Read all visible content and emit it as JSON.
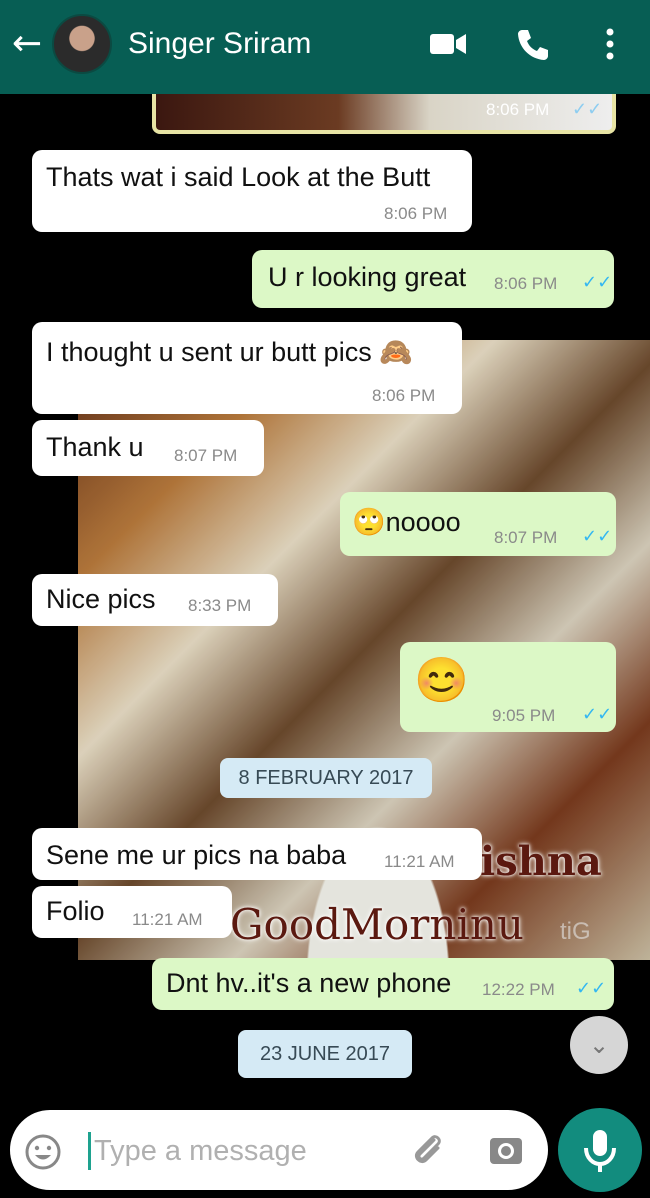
{
  "header": {
    "contact_name": "Singer Sriram",
    "back_icon": "arrow-left-icon",
    "icons": [
      "video-call-icon",
      "phone-call-icon",
      "more-vert-icon"
    ],
    "color": "#075e54"
  },
  "photo_message": {
    "time": "8:06 PM",
    "watermark_a": "ishna",
    "watermark_b": "GoodMorninu",
    "watermark_c": "tiG"
  },
  "messages": [
    {
      "dir": "in",
      "text": "Thats wat i said Look at the Butt",
      "time": "8:06 PM"
    },
    {
      "dir": "out",
      "text": "U r looking great",
      "time": "8:06 PM",
      "ticks": "✓✓"
    },
    {
      "dir": "in",
      "text": "I thought u sent ur butt pics 🙈",
      "time": "8:06 PM"
    },
    {
      "dir": "in",
      "text": "Thank u",
      "time": "8:07 PM"
    },
    {
      "dir": "out",
      "text": "🙄noooo",
      "time": "8:07 PM",
      "ticks": "✓✓"
    },
    {
      "dir": "in",
      "text": "Nice pics",
      "time": "8:33 PM"
    },
    {
      "dir": "out",
      "text": "😊",
      "time": "9:05 PM",
      "ticks": "✓✓"
    },
    {
      "dir": "in",
      "text": "Sene me ur pics na baba",
      "time": "11:21 AM"
    },
    {
      "dir": "in",
      "text": "Folio",
      "time": "11:21 AM"
    },
    {
      "dir": "out",
      "text": "Dnt hv..it's a new phone",
      "time": "12:22 PM",
      "ticks": "✓✓"
    }
  ],
  "dates": [
    "8 FEBRUARY 2017",
    "23 JUNE 2017"
  ],
  "scroll_down_icon": "double-chevron-down-icon",
  "input": {
    "placeholder": "Type a message",
    "icons": [
      "emoji-icon",
      "attach-icon",
      "camera-icon",
      "mic-icon"
    ]
  },
  "colors": {
    "incoming": "#ffffff",
    "outgoing": "#dcf8c6",
    "read_ticks": "#34b7f1",
    "mic_button": "#128c7e"
  }
}
